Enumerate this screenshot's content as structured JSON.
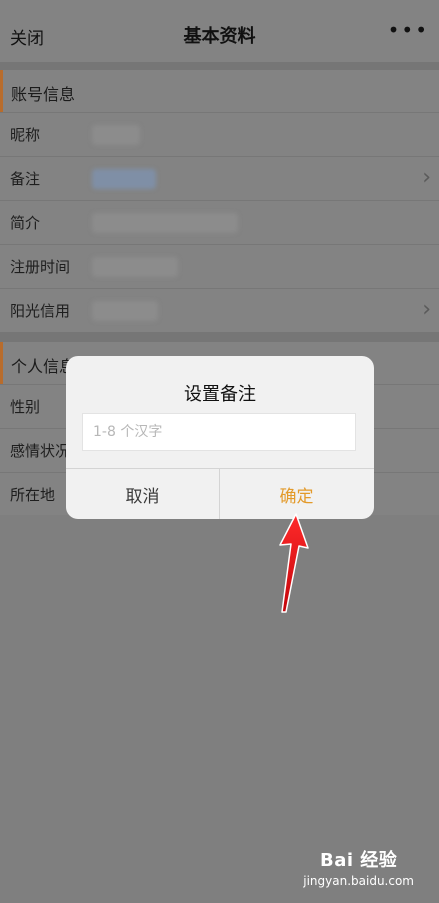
{
  "topbar": {
    "close_label": "关闭",
    "title": "基本资料",
    "more_icon": "more-dots-icon"
  },
  "account_section": {
    "header": "账号信息",
    "rows": [
      {
        "label": "昵称",
        "chevron": false
      },
      {
        "label": "备注",
        "chevron": true
      },
      {
        "label": "简介",
        "chevron": false
      },
      {
        "label": "注册时间",
        "chevron": false
      },
      {
        "label": "阳光信用",
        "chevron": true
      }
    ]
  },
  "personal_section": {
    "header": "个人信息",
    "rows": [
      {
        "label": "性别"
      },
      {
        "label": "感情状况"
      },
      {
        "label": "所在地"
      }
    ]
  },
  "dialog": {
    "title": "设置备注",
    "input_value": "",
    "input_placeholder": "1-8 个汉字",
    "cancel_label": "取消",
    "confirm_label": "确定"
  },
  "watermark": {
    "logo_text": "Bai 经验",
    "url": "jingyan.baidu.com"
  },
  "colors": {
    "confirm": "#e39a2a",
    "section_accent": "#b86c2c",
    "arrow": "#e8141c"
  }
}
